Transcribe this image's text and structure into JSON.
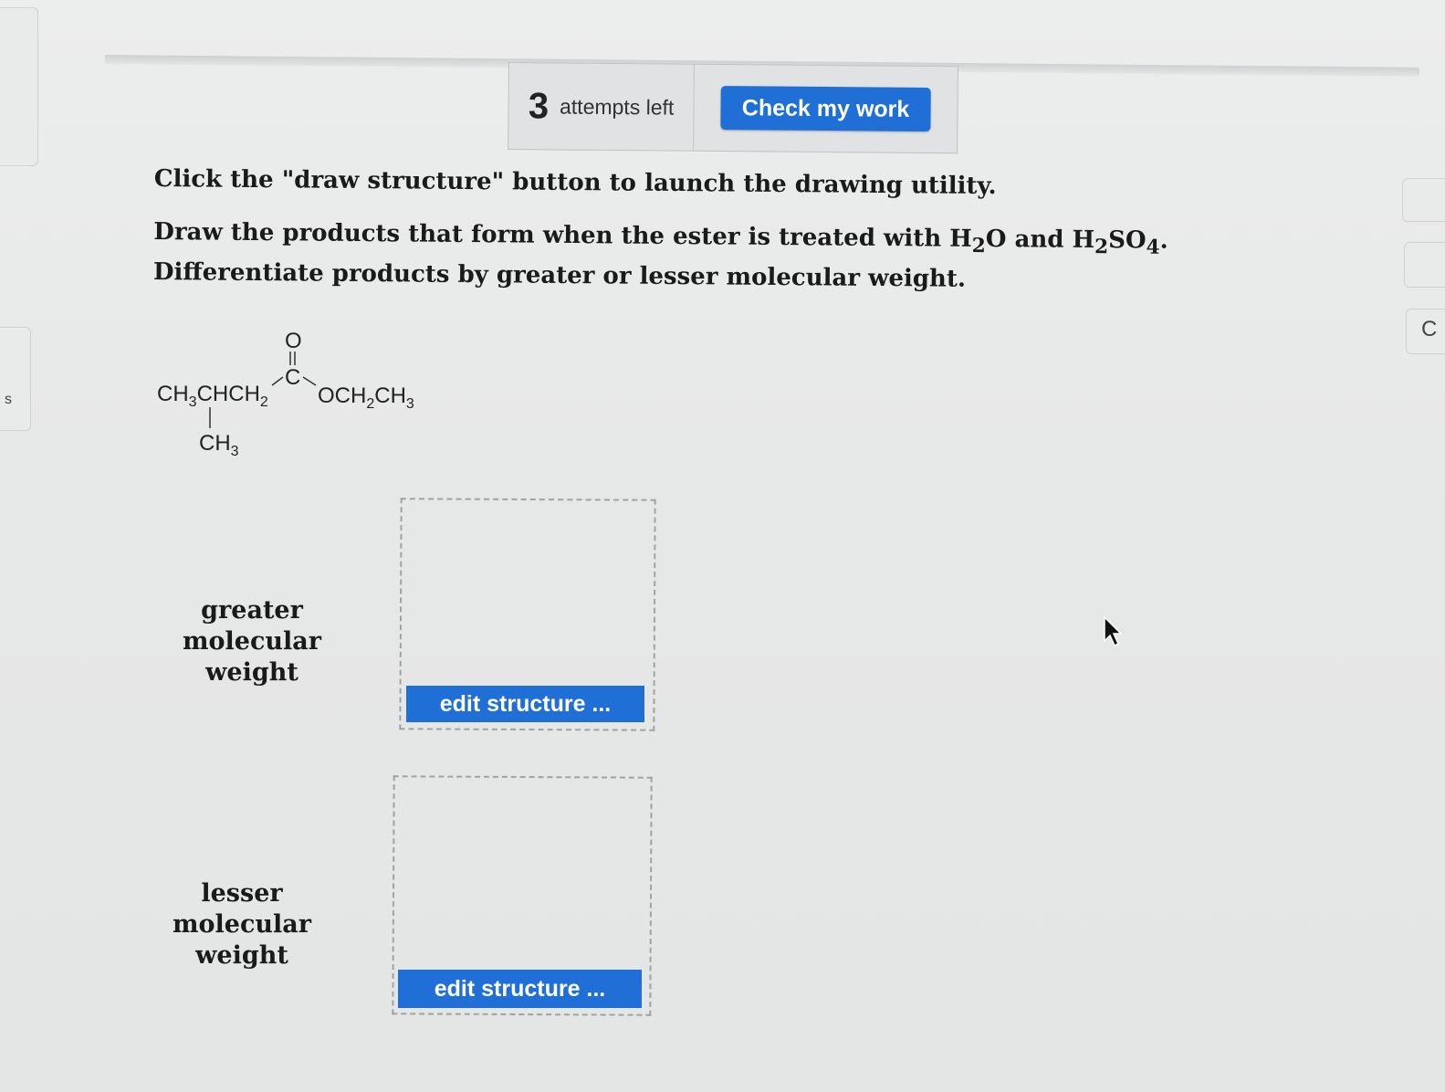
{
  "left_edge": {
    "partial_label": "s"
  },
  "right_edge": {
    "partial_label": "C"
  },
  "toolbar": {
    "attempts_count": "3",
    "attempts_label": "attempts left",
    "check_label": "Check my work"
  },
  "instructions": {
    "line1": "Click the \"draw structure\" button to launch the drawing utility.",
    "line2_a": "Draw the products that form when the ester is treated with H",
    "sub_2a": "2",
    "line2_b": "O and H",
    "sub_2b": "2",
    "line2_c": "SO",
    "sub_4": "4",
    "line2_d": ". Differentiate products by greater or lesser molecular weight."
  },
  "molecule": {
    "oxygen": "O",
    "carbon": "C",
    "left_chain_a": "CH",
    "left_chain_sub1": "3",
    "left_chain_b": "CHCH",
    "left_chain_sub2": "2",
    "right_chain_a": "OCH",
    "right_chain_sub1": "2",
    "right_chain_b": "CH",
    "right_chain_sub2": "3",
    "branch_a": "CH",
    "branch_sub": "3"
  },
  "answers": [
    {
      "label_line1": "greater molecular",
      "label_line2": "weight",
      "button_label": "edit structure ..."
    },
    {
      "label_line1": "lesser molecular",
      "label_line2": "weight",
      "button_label": "edit structure ..."
    }
  ],
  "colors": {
    "button_blue": "#1f6fd6",
    "background": "#e6e7e7"
  }
}
